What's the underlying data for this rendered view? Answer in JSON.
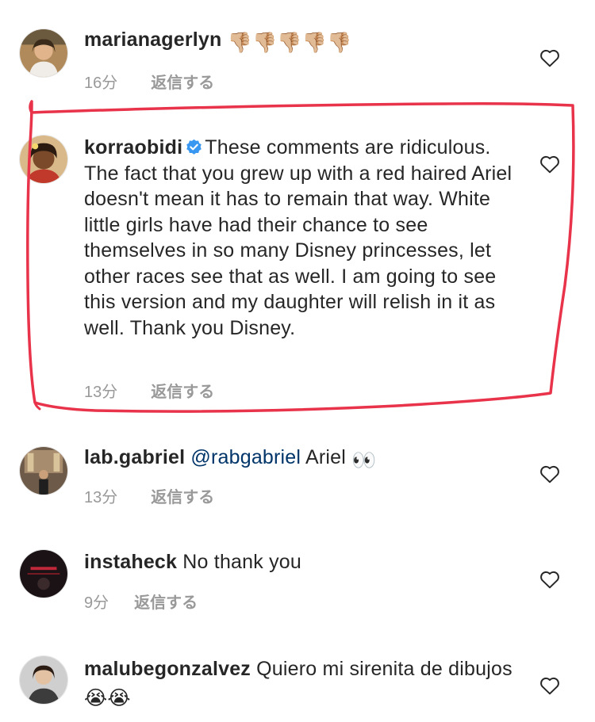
{
  "comments": [
    {
      "username": "marianagerlyn",
      "text": "",
      "emoji": "👎🏼👎🏼👎🏼👎🏼👎🏼",
      "time": "16分",
      "reply_label": "返信する"
    },
    {
      "username": "korraobidi",
      "verified": true,
      "text": "These comments are ridiculous. The fact that you grew up with a red haired Ariel doesn't mean it has to remain that way. White little girls have had their chance to see themselves in so many Disney princesses, let other races see that as well. I am going to see this version and my daughter will relish in it as well. Thank you Disney.",
      "time": "13分",
      "reply_label": "返信する"
    },
    {
      "username": "lab.gabriel",
      "mention": "@rabgabriel",
      "text": "Ariel",
      "emoji": "👀",
      "time": "13分",
      "reply_label": "返信する"
    },
    {
      "username": "instaheck",
      "text": "No thank you",
      "time": "9分",
      "reply_label": "返信する"
    },
    {
      "username": "malubegonzalvez",
      "text": "Quiero mi sirenita de dibujos",
      "emoji": "😭😭"
    }
  ],
  "colors": {
    "text": "#262626",
    "meta": "#999999",
    "mention": "#003569",
    "verified": "#3897f0",
    "highlight": "#e8334a"
  },
  "icons": [
    "heart-outline-icon",
    "verified-badge-icon"
  ]
}
